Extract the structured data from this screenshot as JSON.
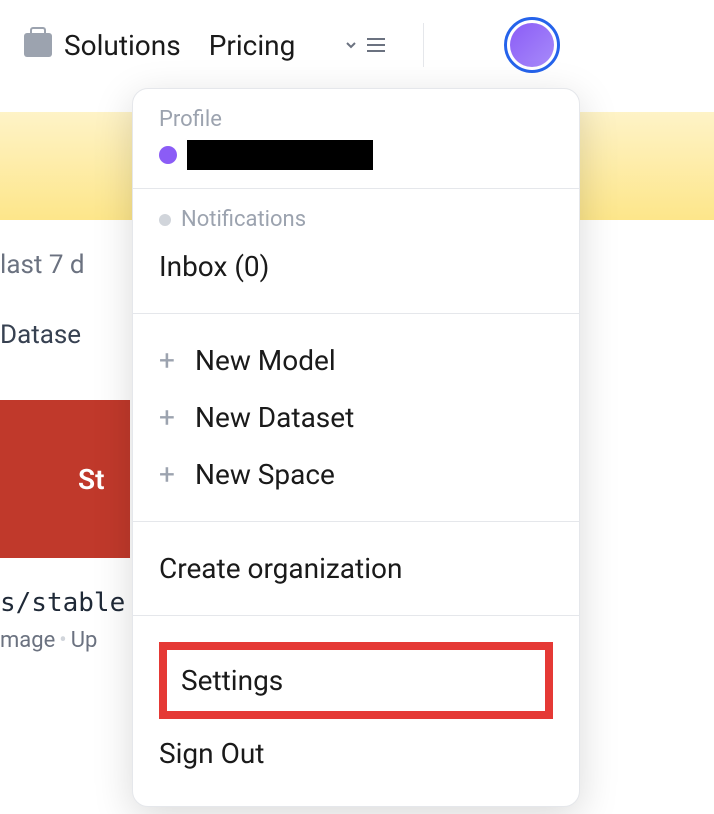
{
  "nav": {
    "solutions": "Solutions",
    "pricing": "Pricing"
  },
  "bg": {
    "trending_suffix": "last 7 d",
    "datasets_prefix": "Datase",
    "card_text": "St",
    "model_path": "s/stable",
    "meta_image": "mage",
    "meta_update": "Up"
  },
  "menu": {
    "profile_label": "Profile",
    "notifications_label": "Notifications",
    "inbox": "Inbox (0)",
    "new_model": "New Model",
    "new_dataset": "New Dataset",
    "new_space": "New Space",
    "create_org": "Create organization",
    "settings": "Settings",
    "sign_out": "Sign Out"
  }
}
